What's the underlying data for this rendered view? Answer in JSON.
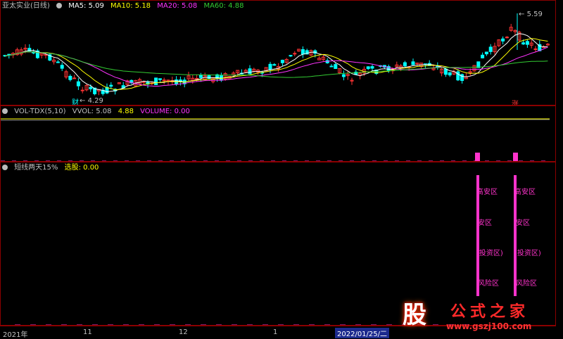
{
  "price_pane": {
    "title": "亚太实业(日线)",
    "ma": [
      {
        "label": "MA5: 5.09",
        "color": "#ffffff"
      },
      {
        "label": "MA10: 5.18",
        "color": "#ffff00"
      },
      {
        "label": "MA20: 5.08",
        "color": "#ff33ff"
      },
      {
        "label": "MA60: 4.88",
        "color": "#33cc33"
      }
    ],
    "high_label": "5.59",
    "low_label": "4.29",
    "marker_cai": "财",
    "marker_zhang": "涨"
  },
  "vol_pane": {
    "title": "VOL-TDX(5,10)",
    "vvol": "VVOL: 5.08",
    "v2": "4.88",
    "volume": "VOLUME: 0.00"
  },
  "ind_pane": {
    "title": "短线两天15%",
    "xuangu": "选股: 0.00",
    "zones": [
      "高安区",
      "安区",
      "(投资区)",
      "风险区"
    ]
  },
  "axis": {
    "labels": [
      "2021年",
      "11",
      "12",
      "1"
    ],
    "date_box": "2022/01/25/二"
  },
  "brand": {
    "logo": "股",
    "name": "公式之家",
    "url": "www.gszj100.com"
  },
  "colors": {
    "up": "#ff3333",
    "down": "#00ffff",
    "ma5": "#ffffff",
    "ma10": "#ffff00",
    "ma20": "#ff33ff",
    "ma60": "#33cc33",
    "signal": "#ff33cc",
    "border": "#8b0000"
  }
}
